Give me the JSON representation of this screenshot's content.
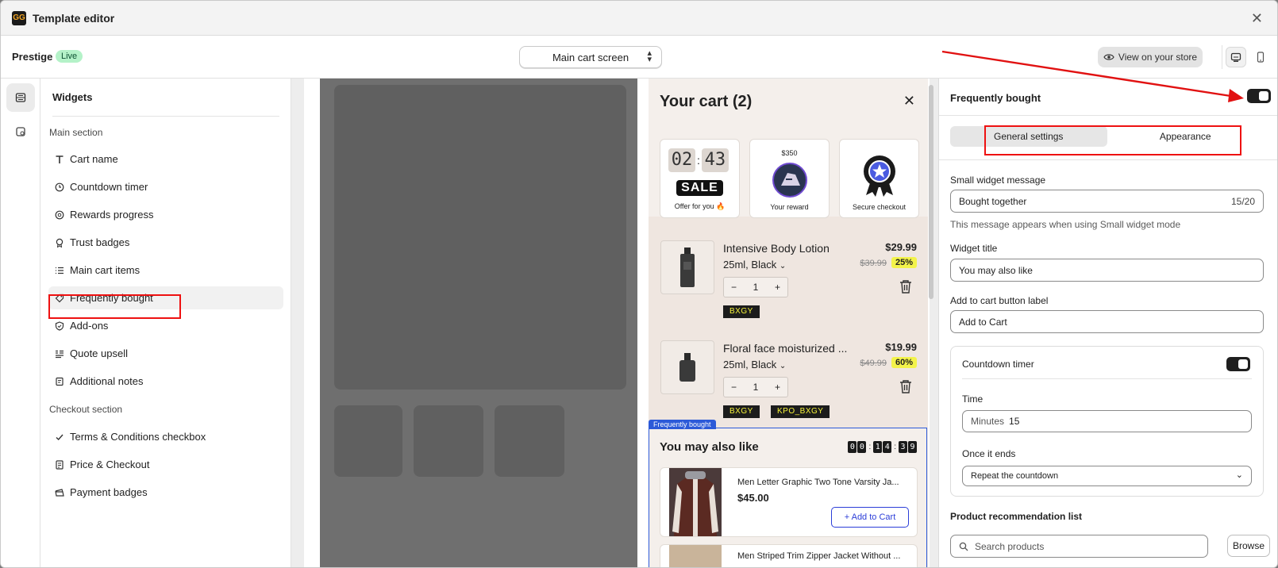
{
  "window": {
    "title": "Template editor",
    "logo_text": "GG"
  },
  "toolbar": {
    "store_name": "Prestige",
    "status_badge": "Live",
    "screen_select": "Main cart screen",
    "view_store": "View on your store"
  },
  "widgets": {
    "title": "Widgets",
    "main_section": "Main section",
    "main_items": [
      {
        "label": "Cart name",
        "icon": "text-icon"
      },
      {
        "label": "Countdown timer",
        "icon": "clock-icon"
      },
      {
        "label": "Rewards progress",
        "icon": "rewards-icon"
      },
      {
        "label": "Trust badges",
        "icon": "badge-icon"
      },
      {
        "label": "Main cart items",
        "icon": "list-icon"
      },
      {
        "label": "Frequently bought",
        "icon": "tag-icon"
      },
      {
        "label": "Add-ons",
        "icon": "shield-icon"
      },
      {
        "label": "Quote upsell",
        "icon": "quote-icon"
      },
      {
        "label": "Additional notes",
        "icon": "note-icon"
      }
    ],
    "checkout_section": "Checkout section",
    "checkout_items": [
      {
        "label": "Terms & Conditions checkbox",
        "icon": "check-icon"
      },
      {
        "label": "Price & Checkout",
        "icon": "receipt-icon"
      },
      {
        "label": "Payment badges",
        "icon": "payment-icon"
      }
    ]
  },
  "cart": {
    "title": "Your cart (2)",
    "promo": {
      "timer_minutes": "02",
      "timer_seconds": "43",
      "sale": "SALE",
      "offer_caption": "Offer for you 🔥",
      "reward_amount": "$350",
      "reward_caption": "Your reward",
      "secure_caption": "Secure checkout"
    },
    "items": [
      {
        "name": "Intensive Body Lotion",
        "variant": "25ml, Black",
        "price": "$29.99",
        "compare": "$39.99",
        "discount": "25%",
        "qty": "1",
        "codes": [
          "BXGY"
        ]
      },
      {
        "name": "Floral face moisturized ...",
        "variant": "25ml, Black",
        "price": "$19.99",
        "compare": "$49.99",
        "discount": "60%",
        "qty": "1",
        "codes": [
          "BXGY",
          "KPO_BXGY"
        ]
      }
    ],
    "fb": {
      "tag": "Frequently bought",
      "title": "You may also like",
      "timer": [
        "0",
        "0",
        "1",
        "4",
        "3",
        "9"
      ],
      "product1_name": "Men Letter Graphic Two Tone Varsity Ja...",
      "product1_price": "$45.00",
      "add_label": "+ Add to Cart",
      "product2_name": "Men Striped Trim Zipper Jacket Without ..."
    }
  },
  "settings": {
    "title": "Frequently bought",
    "tab_general": "General settings",
    "tab_appearance": "Appearance",
    "small_msg_label": "Small widget message",
    "small_msg_value": "Bought together",
    "small_msg_count": "15/20",
    "small_msg_help": "This message appears when using Small widget mode",
    "widget_title_label": "Widget title",
    "widget_title_value": "You may also like",
    "atc_label": "Add to cart button label",
    "atc_value": "Add to Cart",
    "countdown_label": "Countdown timer",
    "time_label": "Time",
    "time_prefix": "Minutes",
    "time_value": "15",
    "once_label": "Once it ends",
    "once_value": "Repeat the countdown",
    "rec_list_label": "Product recommendation list",
    "search_placeholder": "Search products",
    "browse": "Browse"
  },
  "colors": {
    "accent_blue": "#2c5ad8",
    "annotation_red": "#e11111",
    "live_green": "#b4f2c8"
  }
}
